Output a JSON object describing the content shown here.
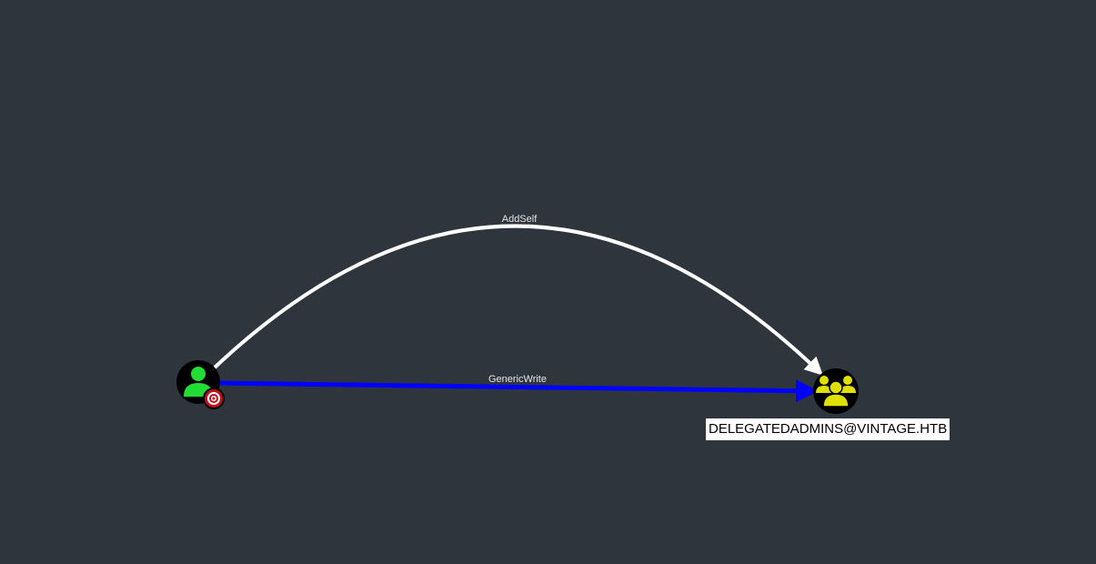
{
  "graph": {
    "edges": [
      {
        "label": "AddSelf",
        "color": "#ffffff"
      },
      {
        "label": "GenericWrite",
        "color": "#0000ff"
      }
    ],
    "nodes": [
      {
        "type": "user",
        "icon": "user-icon",
        "badge": "target-icon",
        "icon_color": "#22dd33",
        "badge_color": "#c0101a"
      },
      {
        "type": "group",
        "icon": "group-icon",
        "label": "DELEGATEDADMINS@VINTAGE.HTB",
        "icon_color": "#e0e000"
      }
    ]
  },
  "colors": {
    "background": "#2e353d",
    "node_fill": "#000000"
  }
}
